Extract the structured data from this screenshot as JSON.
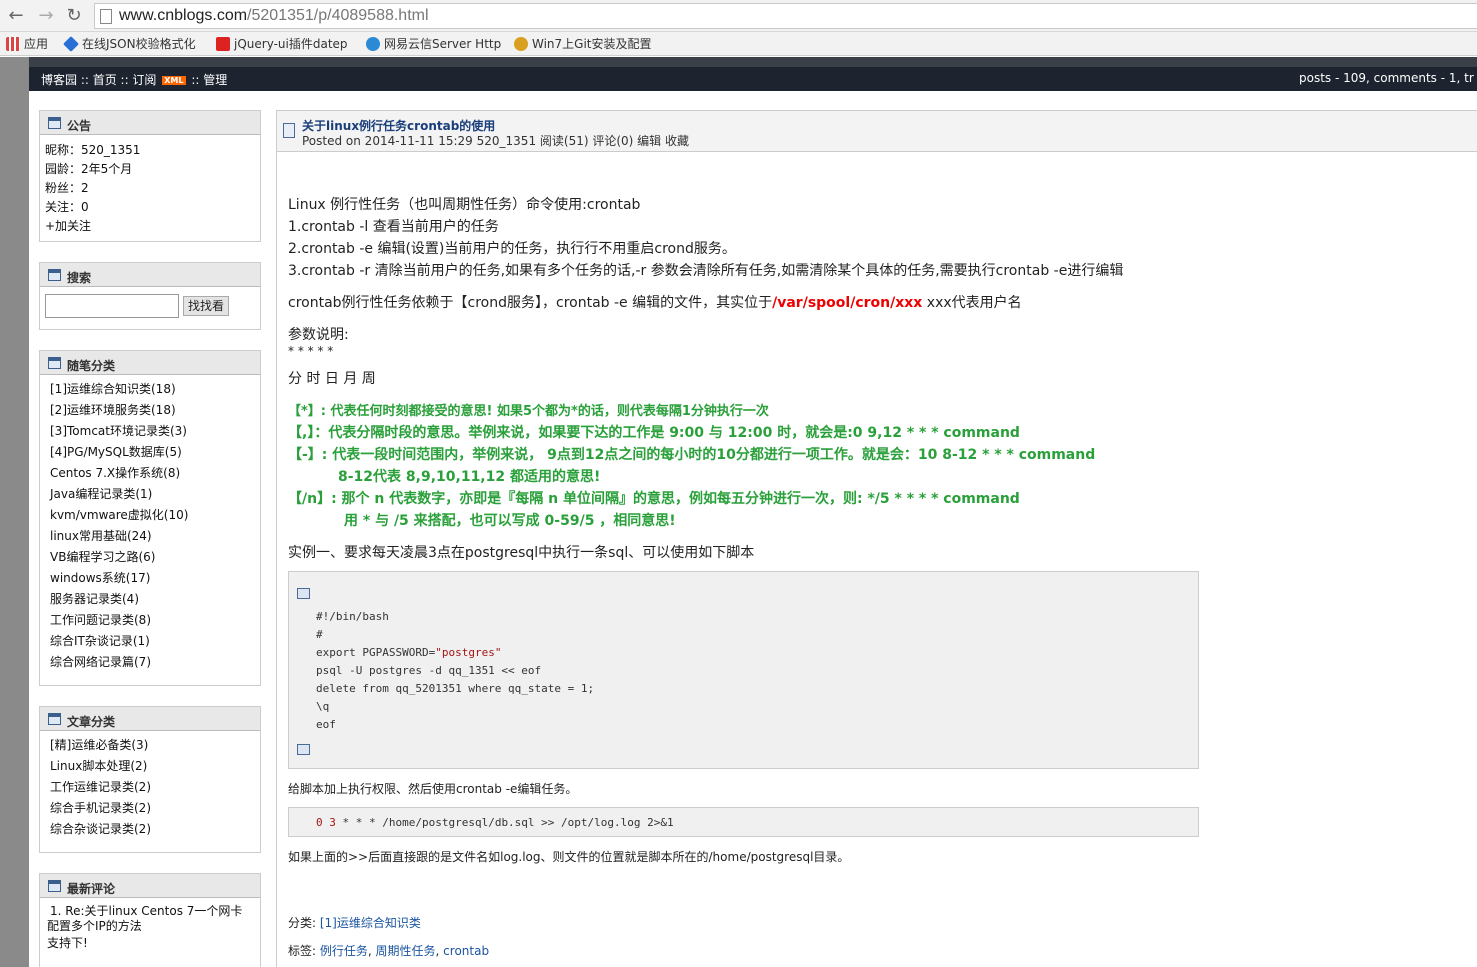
{
  "browser": {
    "url_domain": "www.cnblogs.com",
    "url_path": "/5201351/p/4089588.html",
    "bookmarks": [
      {
        "label": "应用",
        "color": "#d44"
      },
      {
        "label": "在线JSON校验格式化",
        "color": "#2a6fd6"
      },
      {
        "label": "jQuery-ui插件datep",
        "color": "#d22"
      },
      {
        "label": "网易云信Server Http",
        "color": "#2a8ad6"
      },
      {
        "label": "Win7上Git安装及配置",
        "color": "#d9a020"
      }
    ]
  },
  "blogbar": {
    "nav_before": "博客园 :: 首页 :: 订阅",
    "xml_badge": "XML",
    "nav_after": ":: 管理",
    "stats": "posts - 109, comments - 1, tr"
  },
  "sidebar": {
    "notice": {
      "title": "公告",
      "lines": [
        "昵称：520_1351",
        "园龄：2年5个月",
        "粉丝：2",
        "关注：0",
        "+加关注"
      ]
    },
    "search": {
      "title": "搜索",
      "button": "找找看",
      "value": ""
    },
    "post_categories": {
      "title": "随笔分类",
      "items": [
        "[1]运维综合知识类(18)",
        "[2]运维环境服务类(18)",
        "[3]Tomcat环境记录类(3)",
        "[4]PG/MySQL数据库(5)",
        "Centos 7.X操作系统(8)",
        "Java编程记录类(1)",
        "kvm/vmware虚拟化(10)",
        "linux常用基础(24)",
        "VB编程学习之路(6)",
        "windows系统(17)",
        "服务器记录类(4)",
        "工作问题记录类(8)",
        "综合IT杂谈记录(1)",
        "综合网络记录篇(7)"
      ]
    },
    "article_categories": {
      "title": "文章分类",
      "items": [
        "[精]运维必备类(3)",
        "Linux脚本处理(2)",
        "工作运维记录类(2)",
        "综合手机记录类(2)",
        "综合杂谈记录类(2)"
      ]
    },
    "recent_comments": {
      "title": "最新评论",
      "item_line1": "1. Re:关于linux Centos 7一个网卡",
      "item_line2": "配置多个IP的方法",
      "item_line3": "支持下!"
    }
  },
  "post": {
    "title": "关于linux例行任务crontab的使用",
    "meta": "Posted on 2014-11-11 15:29 520_1351 阅读(51) 评论(0) 编辑 收藏",
    "p1": "Linux 例行性任务（也叫周期性任务）命令使用:crontab",
    "p2": "1.crontab -l   查看当前用户的任务",
    "p3": "2.crontab -e   编辑(设置)当前用户的任务，执行行不用重启crond服务。",
    "p4": "3.crontab -r   清除当前用户的任务,如果有多个任务的话,-r 参数会清除所有任务,如需清除某个具体的任务,需要执行crontab -e进行编辑",
    "p5_before": "crontab例行性任务依赖于【crond服务】，crontab -e 编辑的文件，其实位于",
    "p5_red": "/var/spool/cron/xxx",
    "p5_after": " xxx代表用户名",
    "params_label": "参数说明:",
    "stars": "*    *    *    *    *",
    "fields": "分    时    日    月    周",
    "g1": "【*】: 代表任何时刻都接受的意思! 如果5个都为*的话，则代表每隔1分钟执行一次",
    "g2": "【,】：代表分隔时段的意思。举例来说，如果要下达的工作是 9:00 与 12:00 时，就会是:0 9,12 * * * command",
    "g3": "【-】: 代表一段时间范围内，举例来说， 9点到12点之间的每小时的10分都进行一项工作。就是会：10 8-12 * * * command",
    "g3b": "8-12代表 8,9,10,11,12 都适用的意思!",
    "g4": "【/n】: 那个 n 代表数字，亦即是『每隔 n 单位间隔』的意思，例如每五分钟进行一次，则: */5 * * * * command",
    "g4b": "用 * 与 /5 来搭配，也可以写成 0-59/5 ，相同意思!",
    "example_intro": "实例一、要求每天凌晨3点在postgresql中执行一条sql、可以使用如下脚本",
    "code_lines": [
      "#!/bin/bash",
      "#",
      "export PGPASSWORD=",
      "psql -U postgres -d qq_1351 << eof",
      "delete from qq_5201351 where qq_state = 1;",
      "\\q",
      "eof"
    ],
    "code_string": "\"postgres\"",
    "after_code": "给脚本加上执行权限、然后使用crontab -e编辑任务。",
    "cron_nums": "0 3",
    "cron_line": " * * * /home/postgresql/db.sql >> /opt/log.log 2>&1",
    "final_note": "如果上面的>>后面直接跟的是文件名如log.log、则文件的位置就是脚本所在的/home/postgresql目录。",
    "category_label": "分类: ",
    "category_link": "[1]运维综合知识类",
    "tags_label": "标签: ",
    "tags": [
      "例行任务",
      "周期性任务",
      "crontab"
    ]
  }
}
